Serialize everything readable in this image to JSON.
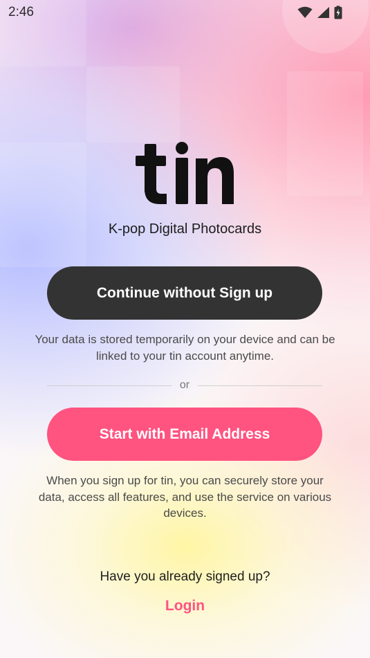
{
  "status_bar": {
    "time": "2:46",
    "icons": [
      "wifi-icon",
      "signal-icon",
      "battery-icon"
    ]
  },
  "brand": {
    "logo_text": "tin",
    "tagline": "K-pop Digital Photocards"
  },
  "actions": {
    "guest_button": "Continue without Sign up",
    "guest_note": "Your data is stored temporarily on your device and can be linked to your tin account anytime.",
    "divider_text": "or",
    "email_button": "Start with Email Address",
    "email_note": "When you sign up for tin, you can securely store your data, access all features, and use the service on various devices."
  },
  "footer": {
    "already_text": "Have you already signed up?",
    "login_link": "Login"
  },
  "colors": {
    "accent": "#ff5380",
    "dark_button": "#333333"
  }
}
